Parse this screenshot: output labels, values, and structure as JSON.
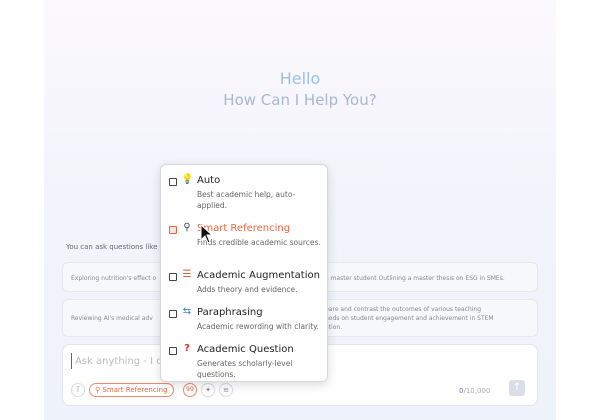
{
  "hero": {
    "greeting": "Hello",
    "subtitle": "How Can I Help You?"
  },
  "hint": "You can ask questions like th",
  "examples": [
    "Exploring nutrition's effect o",
    "a master student Outlining a master thesis on ESG in SMEs.",
    "Reviewing AI's medical adv",
    "pare and contrast the outcomes of various teaching\nhods on student engagement and achievement in STEM\nation."
  ],
  "input": {
    "placeholder": "Ask anything - I c",
    "mode_chip": "Smart Referencing",
    "chip_99": "99",
    "char_count_used": "0",
    "char_count_limit": "/10,000",
    "send_icon": "arrow-up-icon"
  },
  "modes": [
    {
      "title": "Auto",
      "desc": "Best academic help, auto-applied.",
      "icon": "lightbulb-icon",
      "checked": false,
      "active": false
    },
    {
      "title": "Smart Referencing",
      "desc": "Finds credible academic sources.",
      "icon": "magnifier-icon",
      "checked": true,
      "active": true
    },
    {
      "title": "Academic Augmentation",
      "desc": "Adds theory and evidence.",
      "icon": "books-icon",
      "checked": false,
      "active": false
    },
    {
      "title": "Paraphrasing",
      "desc": "Academic rewording with clarity.",
      "icon": "rewrite-icon",
      "checked": false,
      "active": false
    },
    {
      "title": "Academic Question",
      "desc": "Generates scholarly-level questions.",
      "icon": "question-icon",
      "checked": false,
      "active": false
    }
  ],
  "colors": {
    "accent": "#e8663f",
    "hero_hello": "#9cc0e8"
  }
}
